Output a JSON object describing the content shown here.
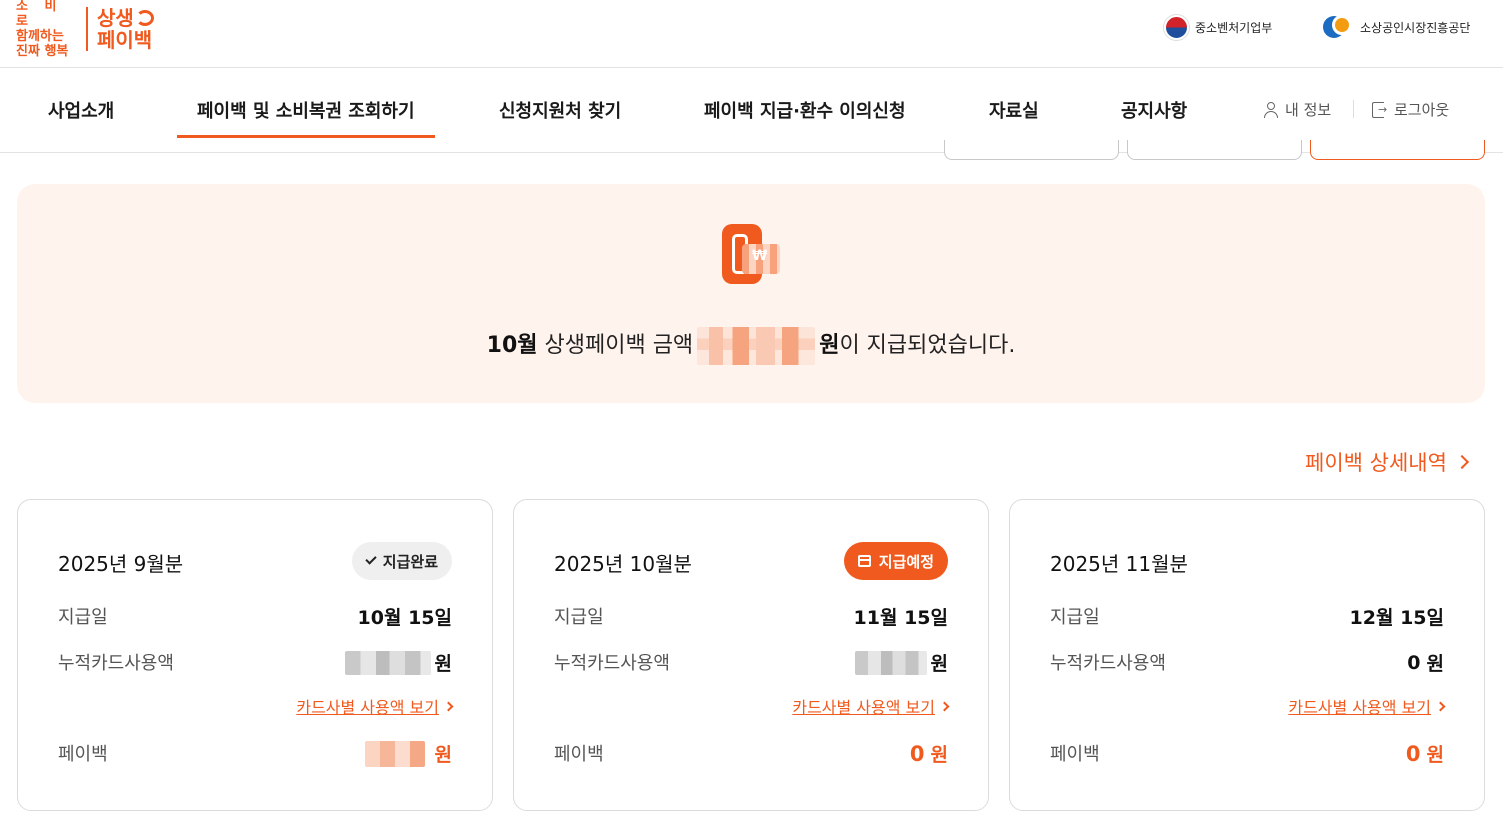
{
  "header": {
    "logo_slogan": [
      "소 비 로",
      "함께하는",
      "진짜 행복"
    ],
    "logo_brand": [
      "상생",
      "페이백"
    ],
    "gov_ministry": "중소벤처기업부",
    "gov_agency": "소상공인시장진흥공단"
  },
  "nav": {
    "items": [
      {
        "label": "사업소개"
      },
      {
        "label": "페이백 및 소비복권 조회하기"
      },
      {
        "label": "신청지원처 찾기"
      },
      {
        "label": "페이백 지급·환수 이의신청"
      },
      {
        "label": "자료실"
      },
      {
        "label": "공지사항"
      }
    ],
    "active_index": 1,
    "my_info": "내 정보",
    "logout": "로그아웃"
  },
  "banner": {
    "month": "10월",
    "text_before": "상생페이백 금액",
    "currency": "원",
    "text_after": "이 지급되었습니다."
  },
  "detail_link": "페이백 상세내역",
  "labels": {
    "pay_date": "지급일",
    "card_usage": "누적카드사용액",
    "card_link": "카드사별 사용액 보기",
    "payback": "페이백",
    "won": "원"
  },
  "cards": [
    {
      "title": "2025년 9월분",
      "badge": "지급완료",
      "pay_date": "10월 15일",
      "card_usage": "",
      "payback": ""
    },
    {
      "title": "2025년 10월분",
      "badge": "지급예정",
      "pay_date": "11월 15일",
      "card_usage": "",
      "payback": "0"
    },
    {
      "title": "2025년 11월분",
      "badge": "",
      "pay_date": "12월 15일",
      "card_usage": "0",
      "payback": "0"
    }
  ],
  "colors": {
    "accent": "#f05a1e",
    "banner_bg": "#fff3ee"
  }
}
